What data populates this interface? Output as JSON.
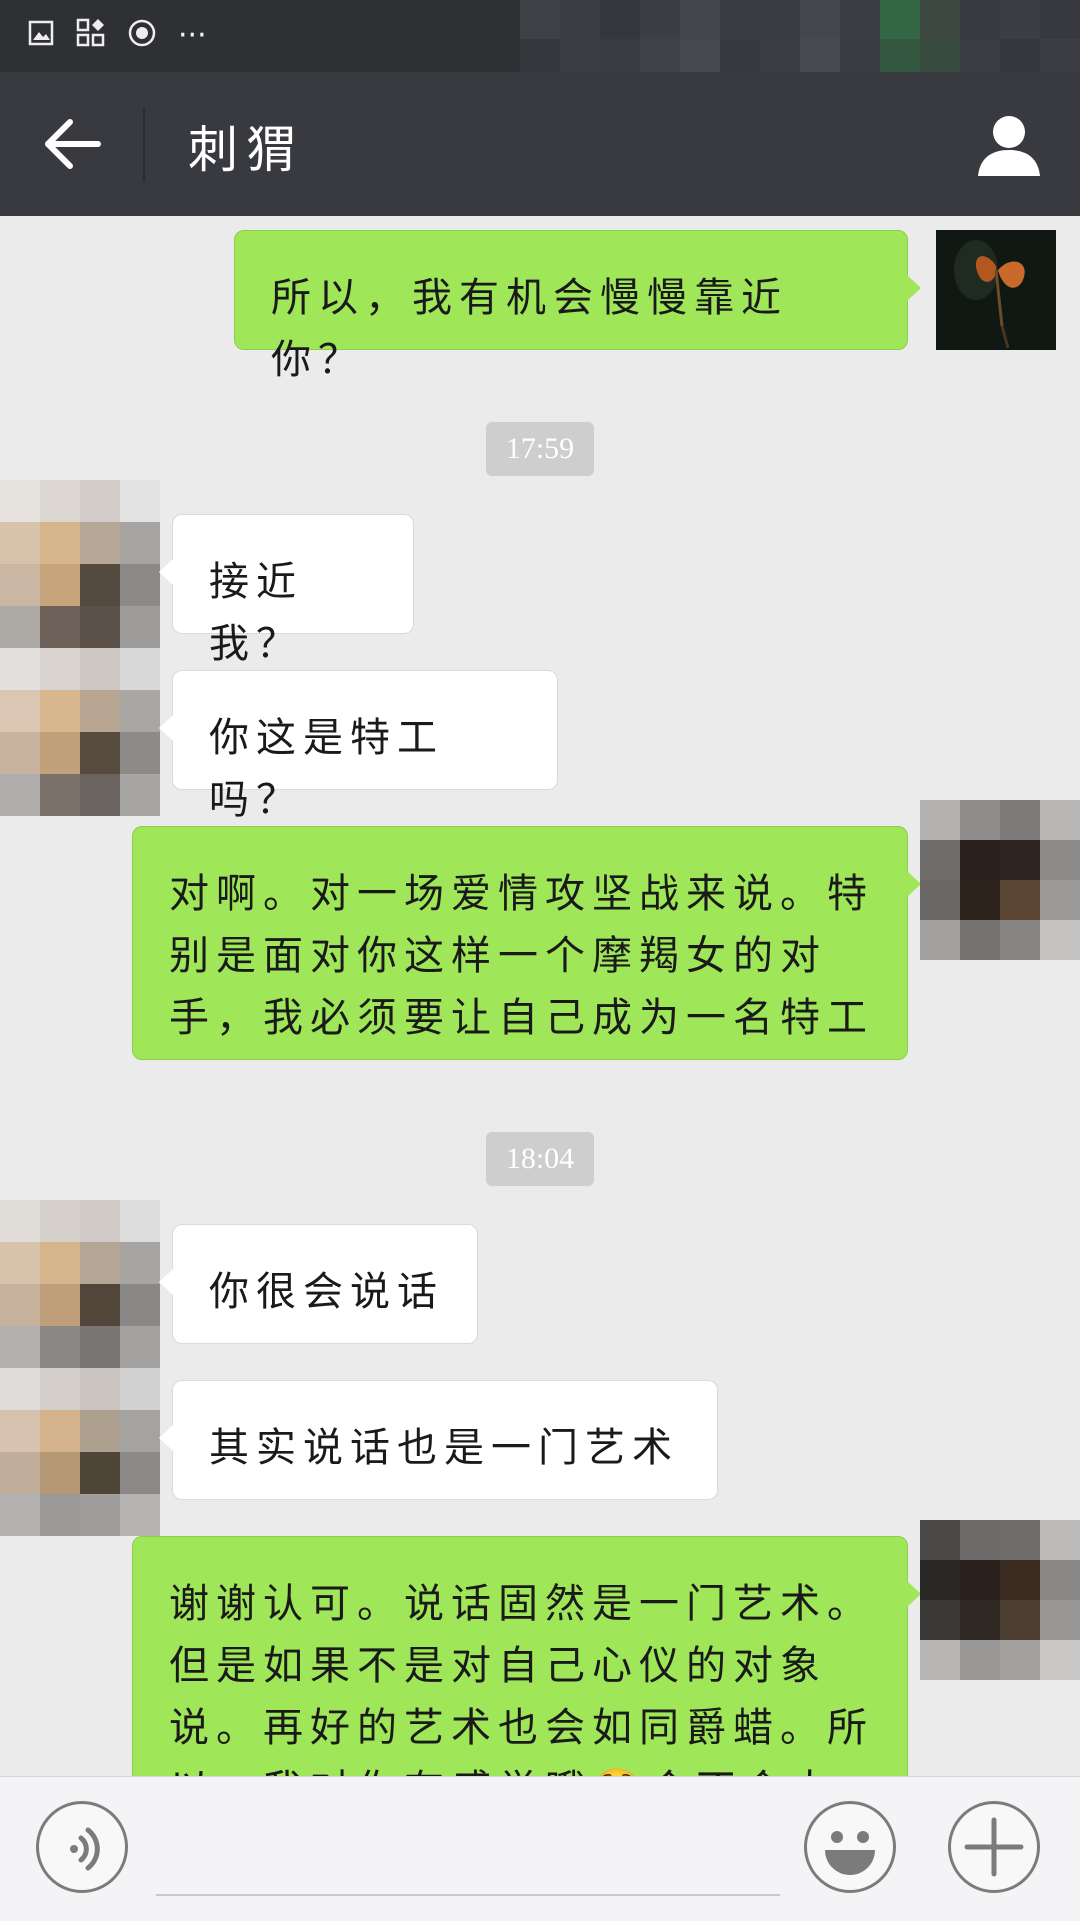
{
  "status_bar": {
    "icons": [
      "image-icon",
      "apps-icon",
      "record-icon",
      "more-icon"
    ],
    "more_label": "···"
  },
  "nav": {
    "title": "刺猬",
    "back_icon": "arrow-left-icon",
    "profile_icon": "person-icon"
  },
  "messages": [
    {
      "from": "me",
      "text": "所以，我有机会慢慢靠近你？"
    },
    {
      "type": "time",
      "text": "17:59"
    },
    {
      "from": "them",
      "text": "接近我？"
    },
    {
      "from": "them",
      "text": "你这是特工吗？"
    },
    {
      "from": "me",
      "text": "对啊。对一场爱情攻坚战来说。特别是面对你这样一个摩羯女的对手，我必须要让自己成为一名特工"
    },
    {
      "type": "time",
      "text": "18:04"
    },
    {
      "from": "them",
      "text": "你很会说话"
    },
    {
      "from": "them",
      "text": "其实说话也是一门艺术"
    },
    {
      "from": "me",
      "text": "谢谢认可。说话固然是一门艺术。但是如果不是对自己心仪的对象说。再好的艺术也会如同爵蜡。所以，我对你有感觉哦😳会不会太直"
    }
  ],
  "input_bar": {
    "voice_icon": "voice-icon",
    "emoji_icon": "emoji-icon",
    "plus_icon": "plus-icon"
  },
  "colors": {
    "status_bar": "#2f3034",
    "nav_bar": "#393a3f",
    "chat_bg": "#ebebeb",
    "my_bubble": "#9fe658",
    "their_bubble": "#ffffff",
    "time_badge": "#cecece"
  }
}
